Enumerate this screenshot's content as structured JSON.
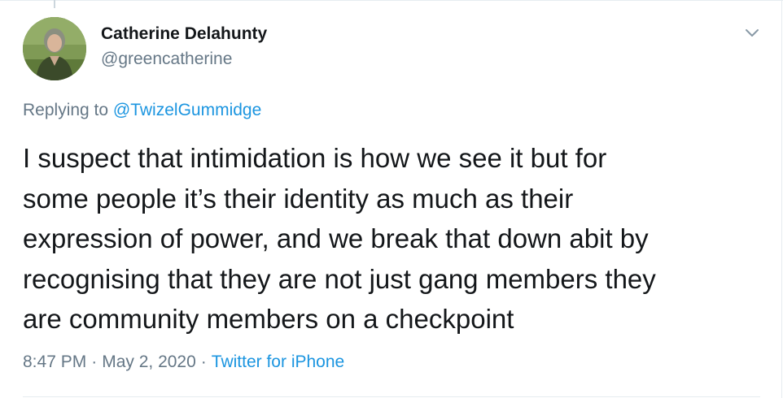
{
  "author": {
    "name": "Catherine Delahunty",
    "handle": "@greencatherine"
  },
  "reply": {
    "prefix": "Replying to ",
    "mention": "@TwizelGummidge"
  },
  "body_lines": [
    "I suspect that intimidation is how we see it but for",
    "some people it’s their identity as much as their",
    "expression of power, and we break that down abit by",
    "recognising that they are not just gang members they",
    "are community members on a checkpoint"
  ],
  "meta": {
    "time": "8:47 PM",
    "separator1": "·",
    "date": "May 2, 2020",
    "separator2": "·",
    "source": "Twitter for iPhone"
  },
  "icons": {
    "menu": "chevron-down-icon",
    "avatar": "profile-photo"
  },
  "colors": {
    "text": "#14171a",
    "secondary": "#657786",
    "link": "#1b95e0",
    "divider": "#e6ecf0"
  }
}
